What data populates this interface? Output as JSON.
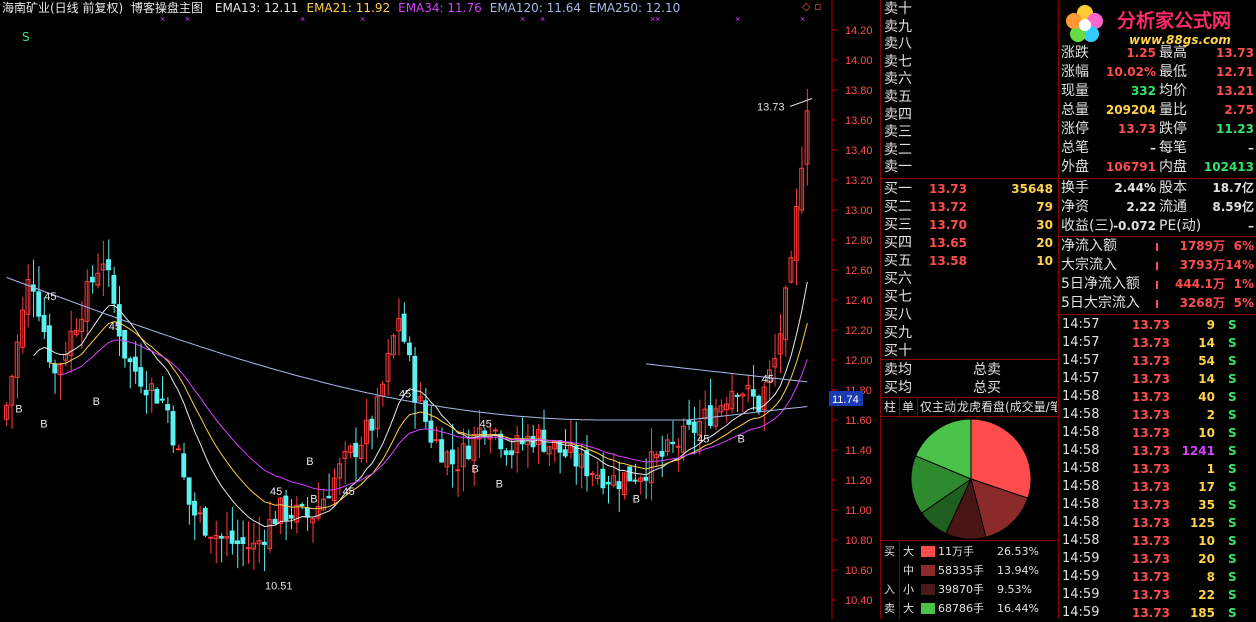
{
  "header": {
    "name": "海南矿业(日线 前复权)",
    "indicator": "博客操盘主图",
    "ema": [
      {
        "label": "EMA13: 12.11",
        "color": "#e8e8e8"
      },
      {
        "label": "EMA21: 11.92",
        "color": "#ffd24a"
      },
      {
        "label": "EMA34: 11.76",
        "color": "#d640ff"
      },
      {
        "label": "EMA120: 11.64",
        "color": "#a8b8e8"
      },
      {
        "label": "EMA250: 12.10",
        "color": "#a8b8e8"
      }
    ],
    "corner_icons": "◇ ▫"
  },
  "chart": {
    "marker_s": "S",
    "max_label": "13.73",
    "min_label": "10.51",
    "current_price": "11.74",
    "y_ticks": [
      "14.20",
      "14.00",
      "13.80",
      "13.60",
      "13.40",
      "13.20",
      "13.00",
      "12.80",
      "12.60",
      "12.40",
      "12.20",
      "12.00",
      "11.80",
      "11.60",
      "11.40",
      "11.20",
      "11.00",
      "10.80",
      "10.60",
      "10.40"
    ],
    "signals": [
      {
        "t": "B",
        "x": 0.014,
        "p": 11.65
      },
      {
        "t": "B",
        "x": 0.045,
        "p": 11.55
      },
      {
        "t": "B",
        "x": 0.11,
        "p": 11.7
      },
      {
        "t": "45",
        "x": 0.05,
        "p": 12.4
      },
      {
        "t": "45",
        "x": 0.13,
        "p": 12.2
      },
      {
        "t": "B",
        "x": 0.375,
        "p": 11.3
      },
      {
        "t": "45",
        "x": 0.33,
        "p": 11.1
      },
      {
        "t": "B",
        "x": 0.38,
        "p": 11.05
      },
      {
        "t": "45",
        "x": 0.42,
        "p": 11.1
      },
      {
        "t": "45",
        "x": 0.49,
        "p": 11.75
      },
      {
        "t": "45",
        "x": 0.59,
        "p": 11.55
      },
      {
        "t": "B",
        "x": 0.58,
        "p": 11.25
      },
      {
        "t": "B",
        "x": 0.61,
        "p": 11.15
      },
      {
        "t": "B",
        "x": 0.78,
        "p": 11.05
      },
      {
        "t": "45",
        "x": 0.86,
        "p": 11.45
      },
      {
        "t": "B",
        "x": 0.91,
        "p": 11.45
      },
      {
        "t": "45",
        "x": 0.94,
        "p": 11.85
      }
    ],
    "colors": {
      "up": "#ff3b3b",
      "down": "#5cf0f0",
      "axis": "#b00000",
      "ema13": "#e8e8e8",
      "ema21": "#ffd24a",
      "ema34": "#d640ff",
      "ema120": "#a8b8e8"
    }
  },
  "orderbook": {
    "asks": [
      "卖十",
      "卖九",
      "卖八",
      "卖七",
      "卖六",
      "卖五",
      "卖四",
      "卖三",
      "卖二",
      "卖一"
    ],
    "bids": [
      {
        "label": "买一",
        "price": "13.73",
        "qty": "35648"
      },
      {
        "label": "买二",
        "price": "13.72",
        "qty": "79"
      },
      {
        "label": "买三",
        "price": "13.70",
        "qty": "30"
      },
      {
        "label": "买四",
        "price": "13.65",
        "qty": "20"
      },
      {
        "label": "买五",
        "price": "13.58",
        "qty": "10"
      },
      {
        "label": "买六",
        "price": "",
        "qty": ""
      },
      {
        "label": "买七",
        "price": "",
        "qty": ""
      },
      {
        "label": "买八",
        "price": "",
        "qty": ""
      },
      {
        "label": "买九",
        "price": "",
        "qty": ""
      },
      {
        "label": "买十",
        "price": "",
        "qty": ""
      }
    ],
    "sell_avg": "卖均",
    "buy_avg": "买均",
    "total_sell": "总卖",
    "total_buy": "总买",
    "tabs": [
      "柱",
      "单",
      "仅主动",
      "龙虎看盘(成交量/笔"
    ],
    "flow_rows": [
      {
        "side": "买",
        "size": "大",
        "amount": "11万手",
        "pct": "26.53%",
        "color": "#ff4d4d"
      },
      {
        "side": "",
        "size": "中",
        "amount": "58335手",
        "pct": "13.94%",
        "color": "#8a2a2a"
      },
      {
        "side": "入",
        "size": "小",
        "amount": "39870手",
        "pct": "9.53%",
        "color": "#4a1a1a"
      },
      {
        "side": "卖",
        "size": "大",
        "amount": "68786手",
        "pct": "16.44%",
        "color": "#4ac24a"
      }
    ],
    "pie": [
      {
        "value": 26.53,
        "color": "#ff4d4d"
      },
      {
        "value": 13.94,
        "color": "#8a2a2a"
      },
      {
        "value": 9.53,
        "color": "#4a1515"
      },
      {
        "value": 7.5,
        "color": "#1f5e1f"
      },
      {
        "value": 14.0,
        "color": "#2e8a2e"
      },
      {
        "value": 16.44,
        "color": "#4ac24a"
      }
    ]
  },
  "quote": {
    "logo_text": "分析家公式网",
    "logo_url": "www.88gs.com",
    "rows": [
      {
        "k1": "涨跌",
        "v1": "1.25",
        "k2": "最高",
        "v2": "13.73",
        "c1": "#ff4d4d",
        "c2": "#ff4d4d"
      },
      {
        "k1": "涨幅",
        "v1": "10.02%",
        "k2": "最低",
        "v2": "12.71",
        "c1": "#ff4d4d",
        "c2": "#ff4d4d"
      },
      {
        "k1": "现量",
        "v1": "332",
        "k2": "均价",
        "v2": "13.21",
        "c1": "#33e36b",
        "c2": "#ff4d4d"
      },
      {
        "k1": "总量",
        "v1": "209204",
        "k2": "量比",
        "v2": "2.75",
        "c1": "#ffd24a",
        "c2": "#ff4d4d"
      },
      {
        "k1": "涨停",
        "v1": "13.73",
        "k2": "跌停",
        "v2": "11.23",
        "c1": "#ff4d4d",
        "c2": "#33e36b"
      },
      {
        "k1": "总笔",
        "v1": "–",
        "k2": "每笔",
        "v2": "–",
        "c1": "#e0e0e0",
        "c2": "#e0e0e0"
      },
      {
        "k1": "外盘",
        "v1": "106791",
        "k2": "内盘",
        "v2": "102413",
        "c1": "#ff4d4d",
        "c2": "#33e36b"
      }
    ],
    "rows2": [
      {
        "k1": "换手",
        "v1": "2.44%",
        "k2": "股本",
        "v2": "18.7亿",
        "c1": "#e0e0e0",
        "c2": "#e0e0e0"
      },
      {
        "k1": "净资",
        "v1": "2.22",
        "k2": "流通",
        "v2": "8.59亿",
        "c1": "#e0e0e0",
        "c2": "#e0e0e0"
      },
      {
        "k1": "收益(三)",
        "v1": "-0.072",
        "k2": "PE(动)",
        "v2": "–",
        "c1": "#e0e0e0",
        "c2": "#e0e0e0"
      }
    ],
    "flows": [
      {
        "k": "净流入额",
        "v": "1789万",
        "p": "6%"
      },
      {
        "k": "大宗流入",
        "v": "3793万",
        "p": "14%"
      },
      {
        "k": "5日净流入额",
        "v": "444.1万",
        "p": "1%"
      },
      {
        "k": "5日大宗流入",
        "v": "3268万",
        "p": "5%"
      }
    ],
    "ticks": [
      {
        "t": "14:57",
        "p": "13.73",
        "v": "9",
        "s": "S",
        "vc": "#ffd24a"
      },
      {
        "t": "14:57",
        "p": "13.73",
        "v": "14",
        "s": "S",
        "vc": "#ffd24a"
      },
      {
        "t": "14:57",
        "p": "13.73",
        "v": "54",
        "s": "S",
        "vc": "#ffd24a"
      },
      {
        "t": "14:57",
        "p": "13.73",
        "v": "14",
        "s": "S",
        "vc": "#ffd24a"
      },
      {
        "t": "14:58",
        "p": "13.73",
        "v": "40",
        "s": "S",
        "vc": "#ffd24a"
      },
      {
        "t": "14:58",
        "p": "13.73",
        "v": "2",
        "s": "S",
        "vc": "#ffd24a"
      },
      {
        "t": "14:58",
        "p": "13.73",
        "v": "10",
        "s": "S",
        "vc": "#ffd24a"
      },
      {
        "t": "14:58",
        "p": "13.73",
        "v": "1241",
        "s": "S",
        "vc": "#d640ff"
      },
      {
        "t": "14:58",
        "p": "13.73",
        "v": "1",
        "s": "S",
        "vc": "#ffd24a"
      },
      {
        "t": "14:58",
        "p": "13.73",
        "v": "17",
        "s": "S",
        "vc": "#ffd24a"
      },
      {
        "t": "14:58",
        "p": "13.73",
        "v": "35",
        "s": "S",
        "vc": "#ffd24a"
      },
      {
        "t": "14:58",
        "p": "13.73",
        "v": "125",
        "s": "S",
        "vc": "#ffd24a"
      },
      {
        "t": "14:58",
        "p": "13.73",
        "v": "10",
        "s": "S",
        "vc": "#ffd24a"
      },
      {
        "t": "14:59",
        "p": "13.73",
        "v": "20",
        "s": "S",
        "vc": "#ffd24a"
      },
      {
        "t": "14:59",
        "p": "13.73",
        "v": "8",
        "s": "S",
        "vc": "#ffd24a"
      },
      {
        "t": "14:59",
        "p": "13.73",
        "v": "22",
        "s": "S",
        "vc": "#ffd24a"
      },
      {
        "t": "14:59",
        "p": "13.73",
        "v": "185",
        "s": "S",
        "vc": "#ffd24a"
      }
    ]
  }
}
